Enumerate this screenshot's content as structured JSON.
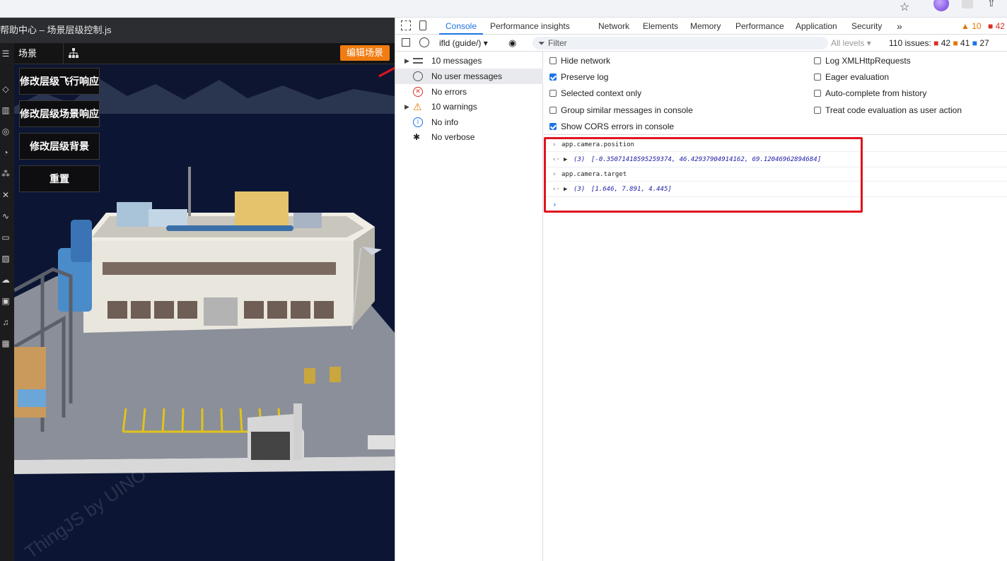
{
  "app": {
    "title": "帮助中心 – 场景层级控制.js",
    "scene_tab": "场景",
    "edit_scene_label": "编辑场景",
    "buttons": [
      "修改层级飞行响应",
      "修改层级场景响应",
      "修改层级背景",
      "重置"
    ],
    "watermark": "ThingJS by UINO"
  },
  "devtools": {
    "tabs": [
      "Console",
      "Performance insights",
      "Network",
      "Elements",
      "Memory",
      "Performance",
      "Application",
      "Security"
    ],
    "active_tab": "Console",
    "warn_count": "10",
    "error_count": "42",
    "context": "ifld (guide/)",
    "filter_placeholder": "Filter",
    "levels": "All levels",
    "issues": {
      "label": "110 issues:",
      "errors": "42",
      "warnings": "41",
      "info": "27"
    },
    "sidebar": [
      {
        "label": "10 messages",
        "icon": "list-icon",
        "expandable": true
      },
      {
        "label": "No user messages",
        "icon": "user-icon",
        "expandable": false
      },
      {
        "label": "No errors",
        "icon": "error-icon",
        "expandable": false
      },
      {
        "label": "10 warnings",
        "icon": "warning-icon",
        "expandable": true
      },
      {
        "label": "No info",
        "icon": "info-icon",
        "expandable": false
      },
      {
        "label": "No verbose",
        "icon": "bug-icon",
        "expandable": false
      }
    ],
    "settings_left": [
      {
        "label": "Hide network",
        "checked": false
      },
      {
        "label": "Preserve log",
        "checked": true
      },
      {
        "label": "Selected context only",
        "checked": false
      },
      {
        "label": "Group similar messages in console",
        "checked": false
      },
      {
        "label": "Show CORS errors in console",
        "checked": true
      }
    ],
    "settings_right": [
      {
        "label": "Log XMLHttpRequests",
        "checked": false
      },
      {
        "label": "Eager evaluation",
        "checked": false
      },
      {
        "label": "Auto-complete from history",
        "checked": false
      },
      {
        "label": "Treat code evaluation as user action",
        "checked": false
      }
    ],
    "console": [
      {
        "kind": "input",
        "text": "app.camera.position"
      },
      {
        "kind": "output",
        "count": "(3)",
        "text": "[-0.35071418595259374, 46.42937904914162, 69.12046962894684]"
      },
      {
        "kind": "input",
        "text": "app.camera.target"
      },
      {
        "kind": "output",
        "count": "(3)",
        "text": "[1.646, 7.891, 4.445]"
      }
    ]
  }
}
